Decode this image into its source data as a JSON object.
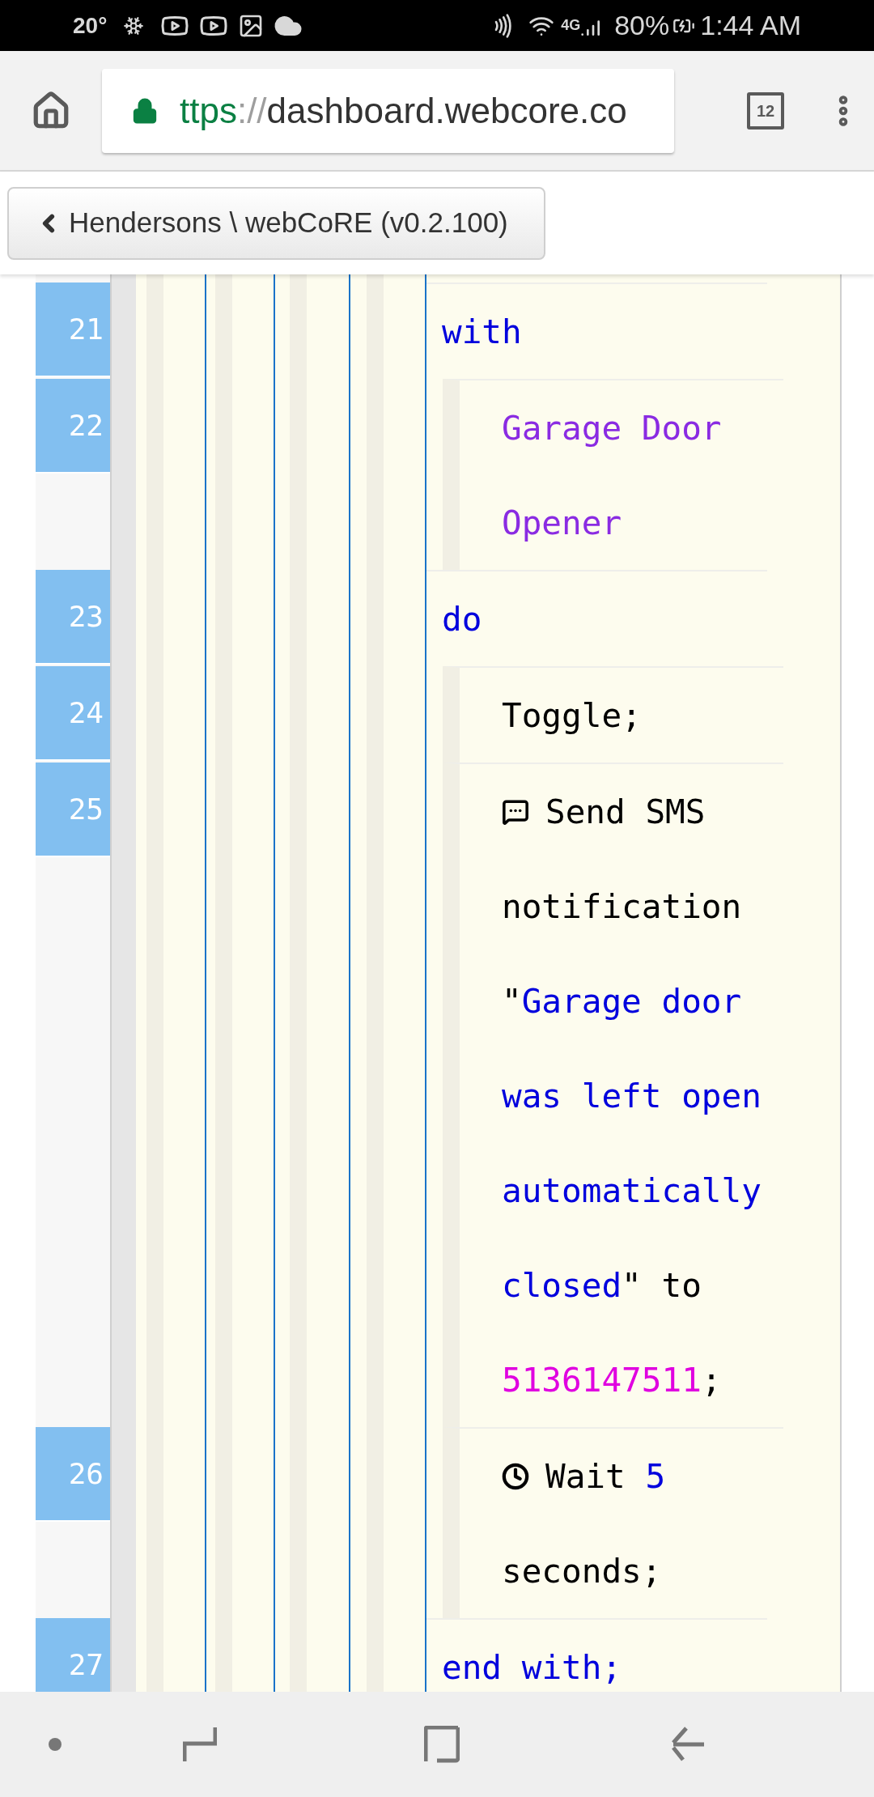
{
  "status_bar": {
    "temperature": "20°",
    "network": "4G",
    "battery": "80%",
    "time": "1:44 AM"
  },
  "browser": {
    "url_scheme": "ttps",
    "url_separator": "://",
    "url_host": "dashboard.webcore.co",
    "tab_count": "12"
  },
  "back_button": {
    "label": "Hendersons \\ webCoRE (v0.2.100)"
  },
  "code_lines": [
    {
      "number": "21",
      "kind": "block",
      "lines": [
        [
          {
            "kind": "keyword",
            "text": "with"
          }
        ]
      ]
    },
    {
      "number": "22",
      "kind": "statement",
      "lines": [
        [
          {
            "kind": "device",
            "text": "Garage Door"
          }
        ],
        [
          {
            "kind": "device",
            "text": "Opener"
          }
        ]
      ]
    },
    {
      "number": "23",
      "kind": "block",
      "lines": [
        [
          {
            "kind": "keyword",
            "text": "do"
          }
        ]
      ]
    },
    {
      "number": "24",
      "kind": "statement",
      "lines": [
        [
          {
            "kind": "plain",
            "text": "Toggle;"
          }
        ]
      ]
    },
    {
      "number": "25",
      "kind": "statement",
      "lines": [
        [
          {
            "kind": "comment-icon"
          },
          {
            "kind": "plain",
            "text": "Send SMS"
          }
        ],
        [
          {
            "kind": "plain",
            "text": "notification"
          }
        ],
        [
          {
            "kind": "plain",
            "text": "\""
          },
          {
            "kind": "string",
            "text": "Garage door"
          }
        ],
        [
          {
            "kind": "string",
            "text": "was left open"
          }
        ],
        [
          {
            "kind": "string",
            "text": "automatically"
          }
        ],
        [
          {
            "kind": "string",
            "text": "closed"
          },
          {
            "kind": "plain",
            "text": "\" to"
          }
        ],
        [
          {
            "kind": "phone",
            "text": "5136147511"
          },
          {
            "kind": "plain",
            "text": ";"
          }
        ]
      ]
    },
    {
      "number": "26",
      "kind": "statement",
      "lines": [
        [
          {
            "kind": "clock-icon"
          },
          {
            "kind": "plain",
            "text": "Wait "
          },
          {
            "kind": "number",
            "text": "5"
          }
        ],
        [
          {
            "kind": "plain",
            "text": "seconds;"
          }
        ]
      ]
    },
    {
      "number": "27",
      "kind": "block",
      "lines": [
        [
          {
            "kind": "keyword",
            "text": "end with;"
          }
        ]
      ]
    }
  ]
}
